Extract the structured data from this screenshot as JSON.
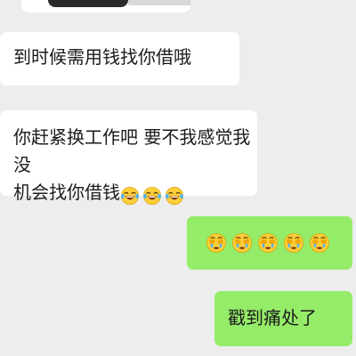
{
  "messages": [
    {
      "direction": "incoming",
      "text": "到时候需用钱找你借哦"
    },
    {
      "direction": "incoming",
      "line1": "你赶紧换工作吧 要不我感觉我没",
      "line2": "机会找你借钱"
    },
    {
      "direction": "outgoing"
    },
    {
      "direction": "outgoing",
      "text": "戳到痛处了"
    }
  ],
  "emoji": {
    "laugh_cry": {
      "name": "laughing-with-tears-emoji",
      "count": 3
    },
    "cover_face_cry": {
      "name": "covering-face-crying-emoji",
      "count": 5
    }
  },
  "colors": {
    "background": "#ededed",
    "incoming_bubble": "#ffffff",
    "outgoing_bubble": "#95ec69",
    "text": "#1b1b1b"
  }
}
